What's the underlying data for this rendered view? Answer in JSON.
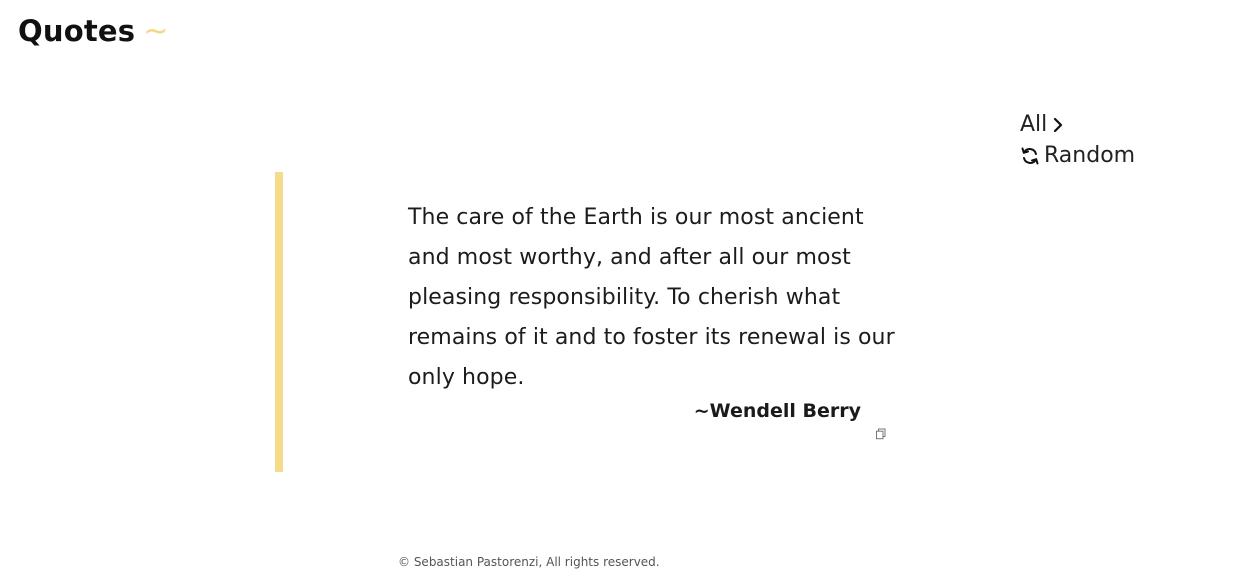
{
  "header": {
    "title": "Quotes",
    "tilde": "~"
  },
  "nav": {
    "all_label": "All",
    "random_label": "Random",
    "icons": {
      "all": "chevron-right-icon",
      "random": "refresh-icon"
    }
  },
  "quote": {
    "text": "The care of the Earth is our most ancient and most worthy, and after all our most pleasing responsibility. To cherish what remains of it and to foster its renewal is our only hope.",
    "author": "~Wendell Berry",
    "copy_icon": "copy-icon"
  },
  "footer": {
    "text": "© Sebastian Pastorenzi, All rights reserved."
  },
  "colors": {
    "accent": "#f5dc8b",
    "text": "#1c1c1c",
    "background": "#ffffff"
  }
}
